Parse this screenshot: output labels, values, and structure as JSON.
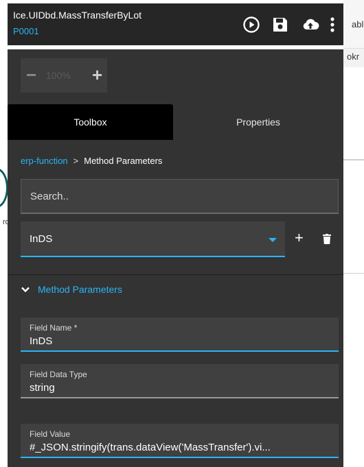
{
  "background": {
    "peek_text_1": "abl",
    "peek_text_2": "okr",
    "peek_text_3": "ro"
  },
  "header": {
    "title": "Ice.UIDbd.MassTransferByLot",
    "subtitle": "P0001",
    "icons": [
      "play-circle-icon",
      "save-icon",
      "cloud-upload-icon",
      "more-vert-icon"
    ]
  },
  "zoom": {
    "minus": "−",
    "value": "100%",
    "plus": "+"
  },
  "tabs": {
    "toolbox": "Toolbox",
    "properties": "Properties"
  },
  "breadcrumb": {
    "link": "erp-function",
    "separator": ">",
    "current": "Method Parameters"
  },
  "search": {
    "placeholder": "Search.."
  },
  "select": {
    "value": "InDS"
  },
  "actions": {
    "add": "+"
  },
  "section": {
    "title": "Method Parameters"
  },
  "fields": [
    {
      "label": "Field Name *",
      "value": "InDS"
    },
    {
      "label": "Field Data Type",
      "value": "string"
    },
    {
      "label": "Field Value",
      "value": "#_JSON.stringify(trans.dataView('MassTransfer').vi..."
    }
  ],
  "colors": {
    "accent": "#29b6f6",
    "panel": "#333333",
    "header": "#262626"
  }
}
